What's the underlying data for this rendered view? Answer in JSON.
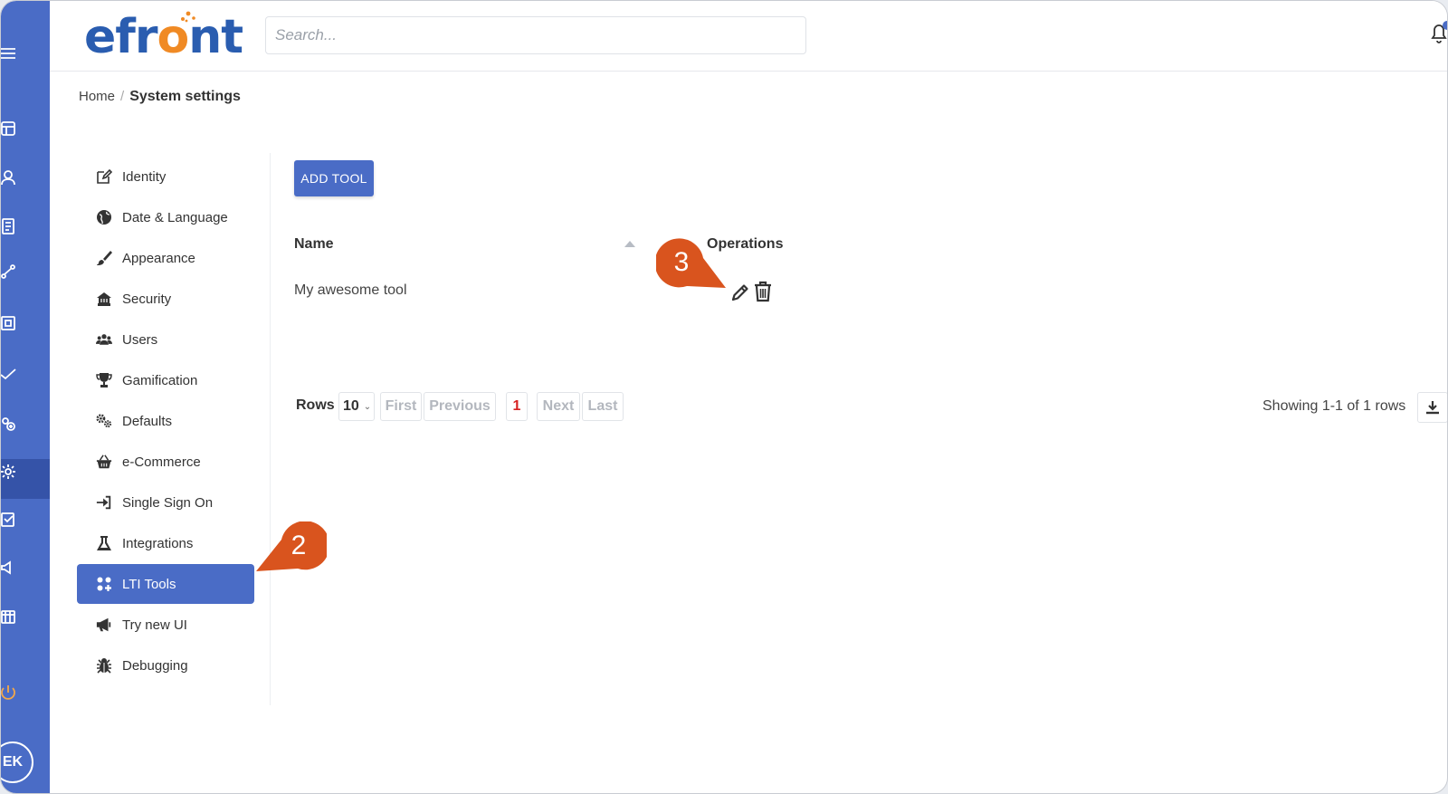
{
  "app": {
    "logo_text_pre": "efr",
    "logo_text_o": "o",
    "logo_text_post": "nt"
  },
  "search": {
    "placeholder": "Search..."
  },
  "breadcrumb": {
    "home": "Home",
    "separator": "/",
    "current": "System settings"
  },
  "rail": {
    "avatar_initials": "EK"
  },
  "settings_nav": {
    "items": [
      {
        "label": "Identity",
        "icon": "edit-icon"
      },
      {
        "label": "Date & Language",
        "icon": "globe-icon"
      },
      {
        "label": "Appearance",
        "icon": "brush-icon"
      },
      {
        "label": "Security",
        "icon": "security-icon"
      },
      {
        "label": "Users",
        "icon": "users-icon"
      },
      {
        "label": "Gamification",
        "icon": "trophy-icon"
      },
      {
        "label": "Defaults",
        "icon": "gears-icon"
      },
      {
        "label": "e-Commerce",
        "icon": "basket-icon"
      },
      {
        "label": "Single Sign On",
        "icon": "sign-in-icon"
      },
      {
        "label": "Integrations",
        "icon": "flask-icon"
      },
      {
        "label": "LTI Tools",
        "icon": "lti-icon",
        "active": true
      },
      {
        "label": "Try new UI",
        "icon": "megaphone-icon"
      },
      {
        "label": "Debugging",
        "icon": "bug-icon"
      }
    ]
  },
  "main": {
    "add_button": "ADD TOOL",
    "table": {
      "columns": [
        "Name",
        "Operations"
      ],
      "rows": [
        {
          "name": "My awesome tool"
        }
      ]
    },
    "pagination": {
      "rows_label": "Rows",
      "rows_value": "10",
      "first": "First",
      "previous": "Previous",
      "current_page": "1",
      "next": "Next",
      "last": "Last",
      "showing": "Showing 1-1 of 1 rows"
    }
  },
  "callouts": {
    "step2": "2",
    "step3": "3"
  },
  "colors": {
    "accent": "#4a6cc6",
    "brand_blue": "#2a5db0",
    "brand_orange": "#f08a24",
    "callout": "#d9541e",
    "current_page": "#d62222"
  }
}
